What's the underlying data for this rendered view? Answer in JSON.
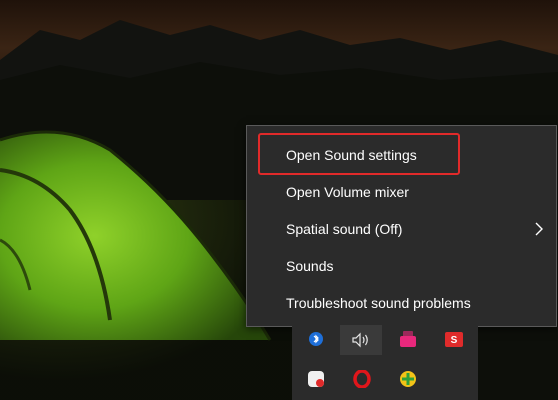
{
  "context_menu": {
    "items": [
      {
        "label": "Open Sound settings",
        "highlighted": true
      },
      {
        "label": "Open Volume mixer"
      },
      {
        "label": "Spatial sound (Off)",
        "has_submenu": true
      },
      {
        "label": "Sounds"
      },
      {
        "label": "Troubleshoot sound problems"
      }
    ],
    "highlight_color": "#e12a2a"
  },
  "tray_icons": [
    {
      "name": "bluetooth-icon"
    },
    {
      "name": "volume-icon"
    },
    {
      "name": "pink-app-icon"
    },
    {
      "name": "red-app-icon"
    },
    {
      "name": "white-app-icon"
    },
    {
      "name": "opera-icon"
    },
    {
      "name": "green-app-icon"
    }
  ]
}
